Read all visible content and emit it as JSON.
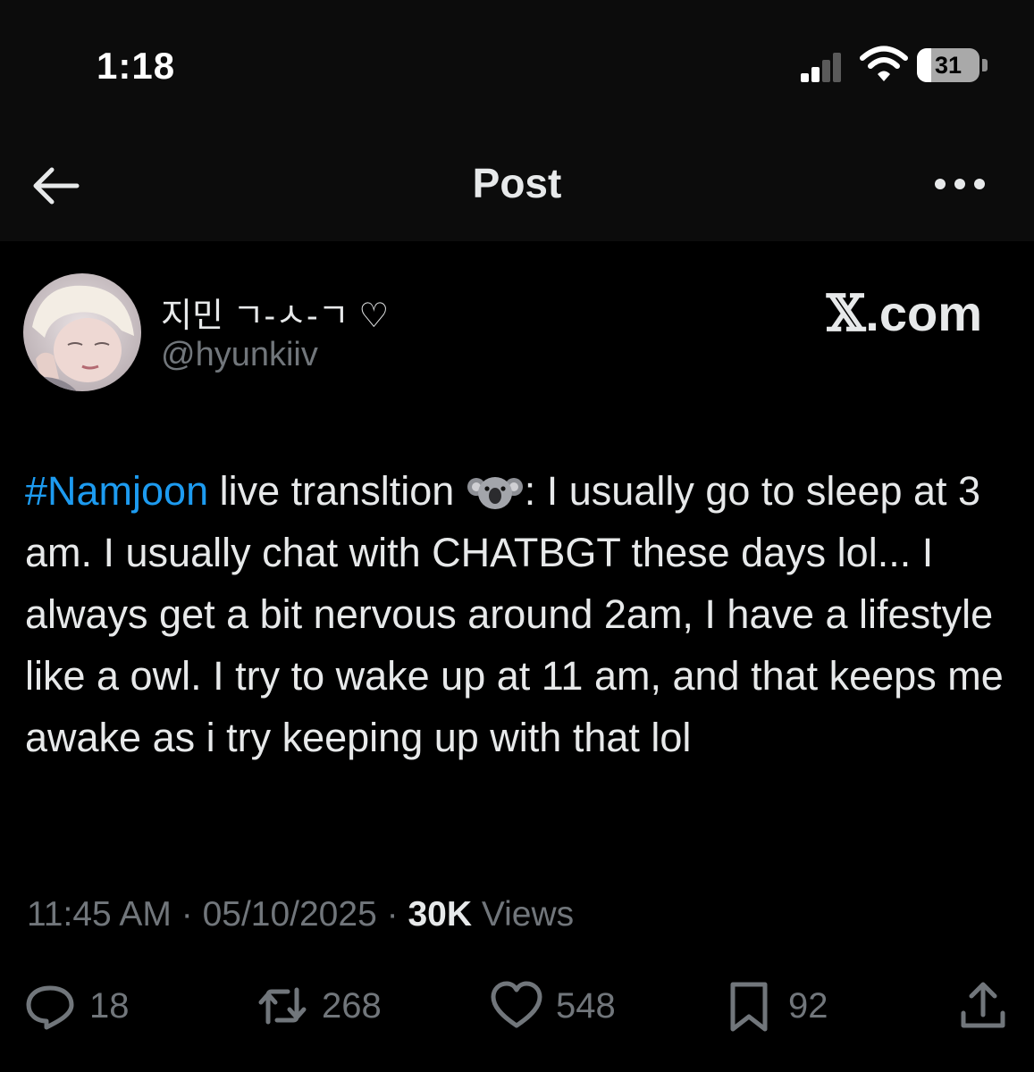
{
  "status_bar": {
    "time": "1:18",
    "battery": "31",
    "icons": [
      "signal-icon",
      "wifi-icon",
      "battery-icon"
    ]
  },
  "nav": {
    "title": "Post",
    "back_icon": "arrow-left-icon",
    "more_icon": "more-icon"
  },
  "author": {
    "display_name": "지민 ㄱ-ㅅ-ㄱ ♡",
    "handle": "@hyunkiiv"
  },
  "watermark": {
    "logo_glyph": "𝕏",
    "text": ".com"
  },
  "tweet": {
    "hashtag": "#Namjoon",
    "text_before_emoji": " live translt​ion ",
    "emoji": "koala-emoji",
    "text_after_emoji": ": I usually go to sleep at 3 am. I usually chat with CHATBGT these days lol... I always get a bit nervous around 2am, I have a lifestyle like a owl. I try to wake up at 11 am, and that keeps me awake as i try keeping up with that lol"
  },
  "meta": {
    "time": "11:45 AM",
    "separator": " · ",
    "date": "05/10/2025",
    "views_count": "30K",
    "views_label": " Views"
  },
  "actions": {
    "replies": "18",
    "reposts": "268",
    "likes": "548",
    "bookmarks": "92"
  },
  "colors": {
    "background": "#000000",
    "link": "#1d9bf0",
    "muted": "#71767b",
    "text": "#e7e9ea"
  }
}
